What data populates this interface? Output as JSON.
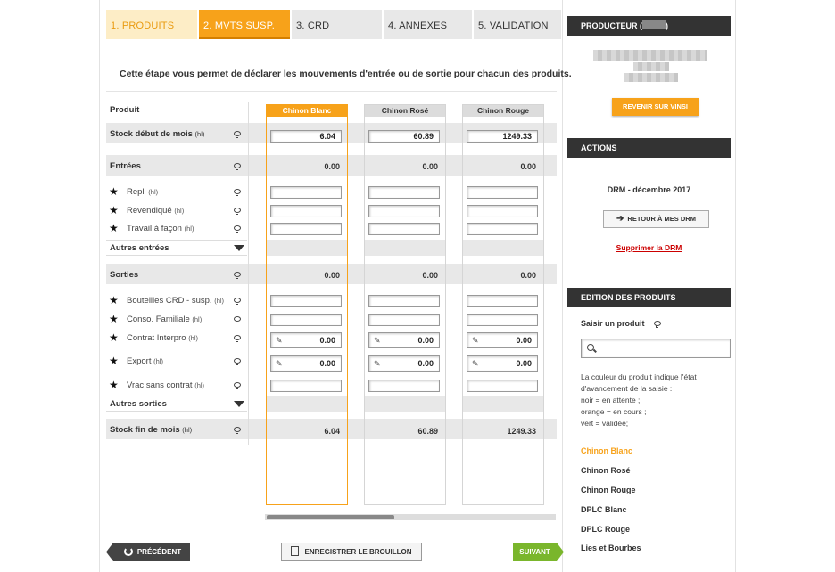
{
  "steps": [
    {
      "label": "1.  PRODUITS"
    },
    {
      "label": "2.  MVTS SUSP."
    },
    {
      "label": "3.  CRD"
    },
    {
      "label": "4.  ANNEXES"
    },
    {
      "label": "5.  VALIDATION"
    }
  ],
  "intro": "Cette étape vous permet de déclarer les mouvements d'entrée ou de sortie pour chacun des produits.",
  "rows": {
    "produit": "Produit",
    "stock_debut": "Stock début de mois",
    "stock_debut_unit": "(hl)",
    "entrees": "Entrées",
    "repli": "Repli",
    "revendique": "Revendiqué",
    "travail": "Travail à façon",
    "autres_entrees": "Autres entrées",
    "sorties": "Sorties",
    "bouteilles": "Bouteilles CRD - susp.",
    "conso": "Conso. Familiale",
    "contrat": "Contrat Interpro",
    "export": "Export",
    "vrac": "Vrac sans contrat",
    "autres_sorties": "Autres sorties",
    "stock_fin": "Stock fin de mois",
    "unit": "(hl)"
  },
  "products": [
    {
      "name": "Chinon Blanc",
      "stock_debut": "6.04",
      "entrees": "0.00",
      "sorties": "0.00",
      "contrat": "0.00",
      "export": "0.00",
      "stock_fin": "6.04"
    },
    {
      "name": "Chinon Rosé",
      "stock_debut": "60.89",
      "entrees": "0.00",
      "sorties": "0.00",
      "contrat": "0.00",
      "export": "0.00",
      "stock_fin": "60.89"
    },
    {
      "name": "Chinon Rouge",
      "stock_debut": "1249.33",
      "entrees": "0.00",
      "sorties": "0.00",
      "contrat": "0.00",
      "export": "0.00",
      "stock_fin": "1249.33"
    }
  ],
  "buttons": {
    "precedent": "PRÉCÉDENT",
    "brouillon": "ENREGISTRER LE BROUILLON",
    "suivant": "SUIVANT"
  },
  "sidebar": {
    "producteur_title": "PRODUCTEUR (",
    "producteur_close": ")",
    "revenir": "REVENIR SUR VINSI",
    "actions_title": "ACTIONS",
    "drm": "DRM - décembre 2017",
    "retour": "RETOUR À MES DRM",
    "supprimer": "Supprimer la DRM",
    "edition_title": "EDITION DES PRODUITS",
    "saisir": "Saisir un produit",
    "legend": [
      "La couleur du produit indique l'état",
      "d'avancement de la saisie :",
      "noir = en attente ;",
      "orange = en cours ;",
      "vert = validée;"
    ],
    "products": [
      "Chinon Blanc",
      "Chinon Rosé",
      "Chinon Rouge",
      "DPLC Blanc",
      "DPLC Rouge",
      "Lies et Bourbes"
    ]
  },
  "colors": {
    "accent": "#f7a21a",
    "success": "#7ab62c",
    "danger": "#cc0000",
    "dark": "#333333"
  }
}
